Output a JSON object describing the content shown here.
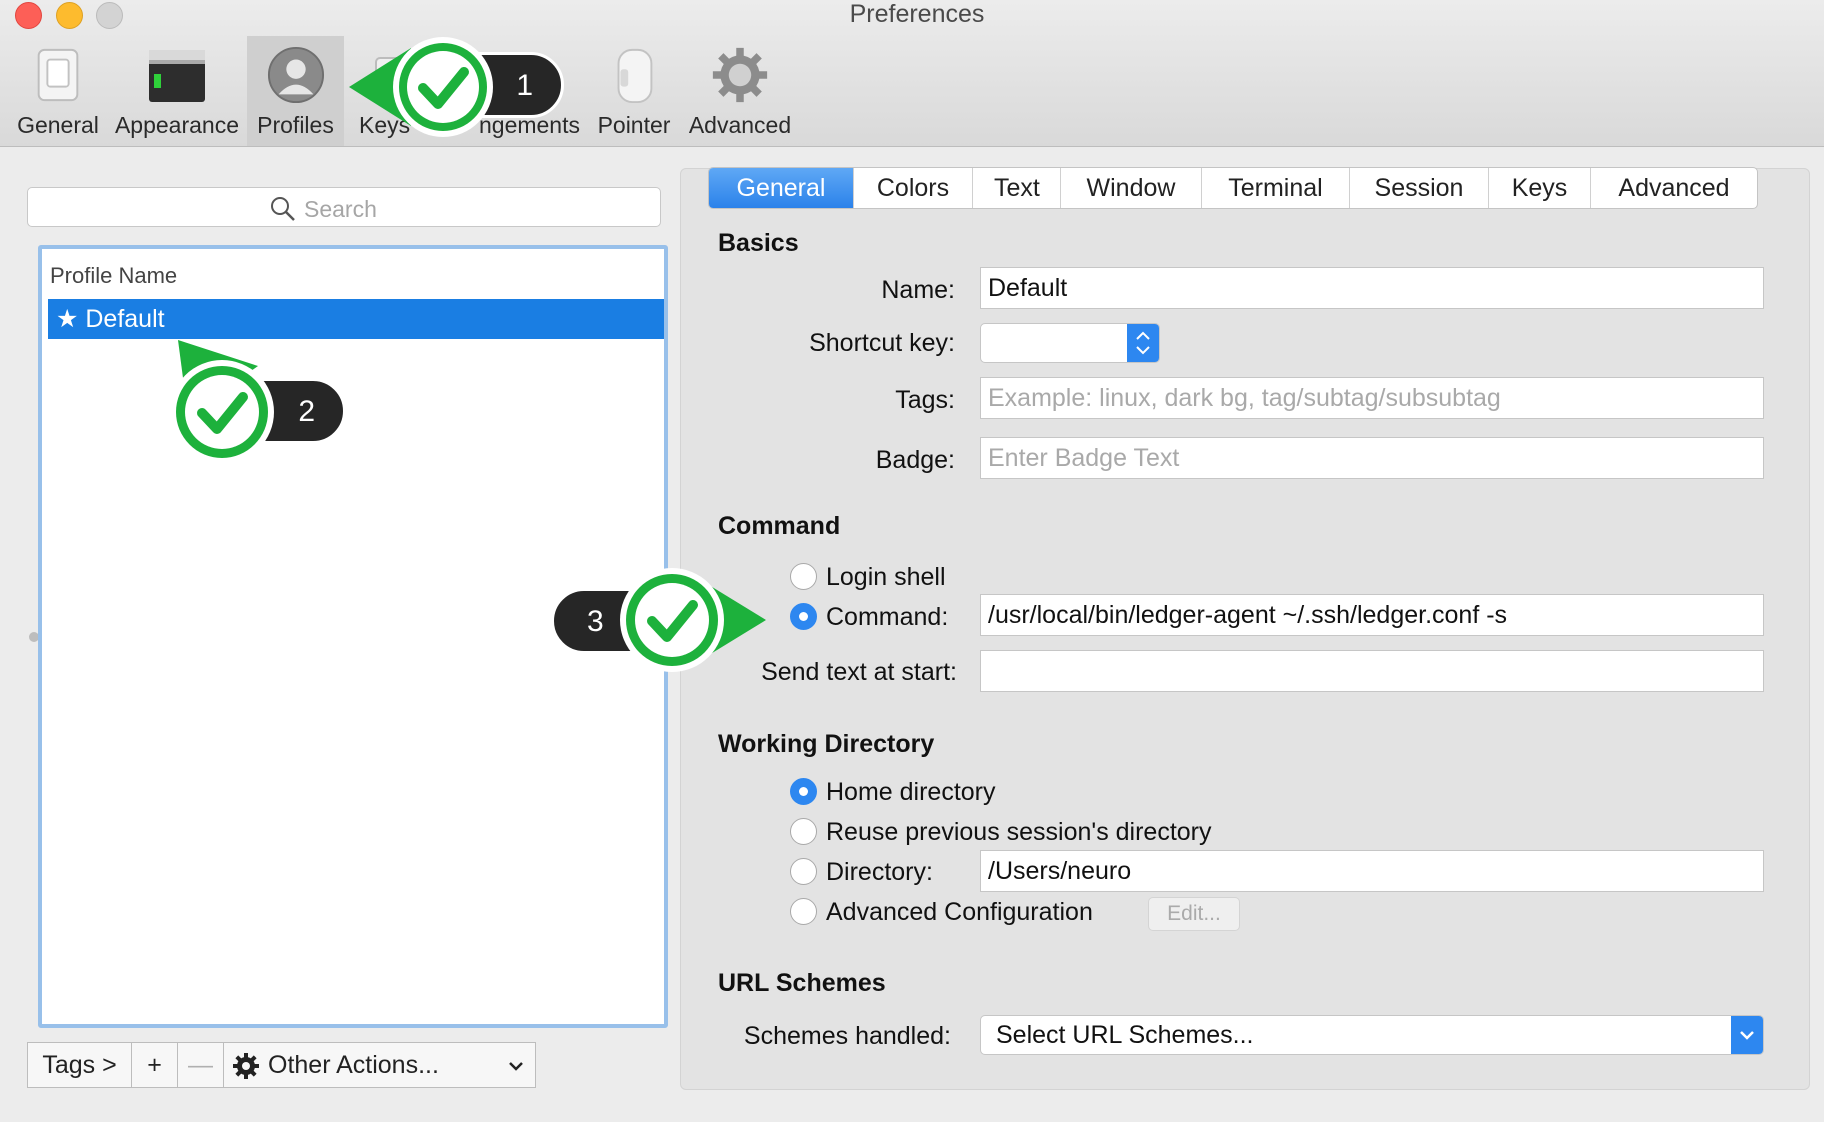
{
  "window": {
    "title": "Preferences"
  },
  "colors": {
    "accent": "#2b82ea",
    "callout_green": "#1db13c",
    "callout_dark": "#2a2a2a",
    "close": "#fd5f57",
    "minimize": "#fdbb2e",
    "zoom": "#cfcfcf"
  },
  "toolbar": {
    "items": [
      {
        "label": "General",
        "icon": "switch-icon"
      },
      {
        "label": "Appearance",
        "icon": "terminal-window-icon"
      },
      {
        "label": "Profiles",
        "icon": "user-silhouette-icon",
        "selected": true
      },
      {
        "label": "Keys",
        "icon": "keyboard-icon"
      },
      {
        "label": "Arrangements",
        "icon": "window-arrangement-icon"
      },
      {
        "label": "Pointer",
        "icon": "mouse-icon"
      },
      {
        "label": "Advanced",
        "icon": "gear-icon"
      }
    ],
    "keys_visible": "Keys",
    "arrangements_visible": "ngements"
  },
  "profiles": {
    "search_placeholder": "Search",
    "column_header": "Profile Name",
    "rows": [
      {
        "name": "Default",
        "default": true,
        "display": "★ Default"
      }
    ],
    "tags_button": "Tags >",
    "add_button": "+",
    "remove_button": "—",
    "other_actions": "Other Actions..."
  },
  "tabs": [
    "General",
    "Colors",
    "Text",
    "Window",
    "Terminal",
    "Session",
    "Keys",
    "Advanced"
  ],
  "active_tab": "General",
  "basics": {
    "heading": "Basics",
    "name_label": "Name:",
    "name_value": "Default",
    "shortcut_label": "Shortcut key:",
    "shortcut_value": "",
    "tags_label": "Tags:",
    "tags_placeholder": "Example: linux, dark bg, tag/subtag/subsubtag",
    "badge_label": "Badge:",
    "badge_placeholder": "Enter Badge Text"
  },
  "command": {
    "heading": "Command",
    "login_shell": "Login shell",
    "command_label": "Command:",
    "command_value": "/usr/local/bin/ledger-agent ~/.ssh/ledger.conf -s",
    "selected": "Command",
    "send_text_label": "Send text at start:",
    "send_text_value": ""
  },
  "working_directory": {
    "heading": "Working Directory",
    "home": "Home directory",
    "reuse": "Reuse previous session's directory",
    "directory_label": "Directory:",
    "directory_value": "/Users/neuro",
    "advanced": "Advanced Configuration",
    "edit_button": "Edit...",
    "selected": "Home directory"
  },
  "url_schemes": {
    "heading": "URL Schemes",
    "label": "Schemes handled:",
    "value": "Select URL Schemes..."
  },
  "callouts": [
    {
      "number": "1",
      "icon": "checkmark-icon"
    },
    {
      "number": "2",
      "icon": "checkmark-icon"
    },
    {
      "number": "3",
      "icon": "checkmark-icon"
    }
  ]
}
